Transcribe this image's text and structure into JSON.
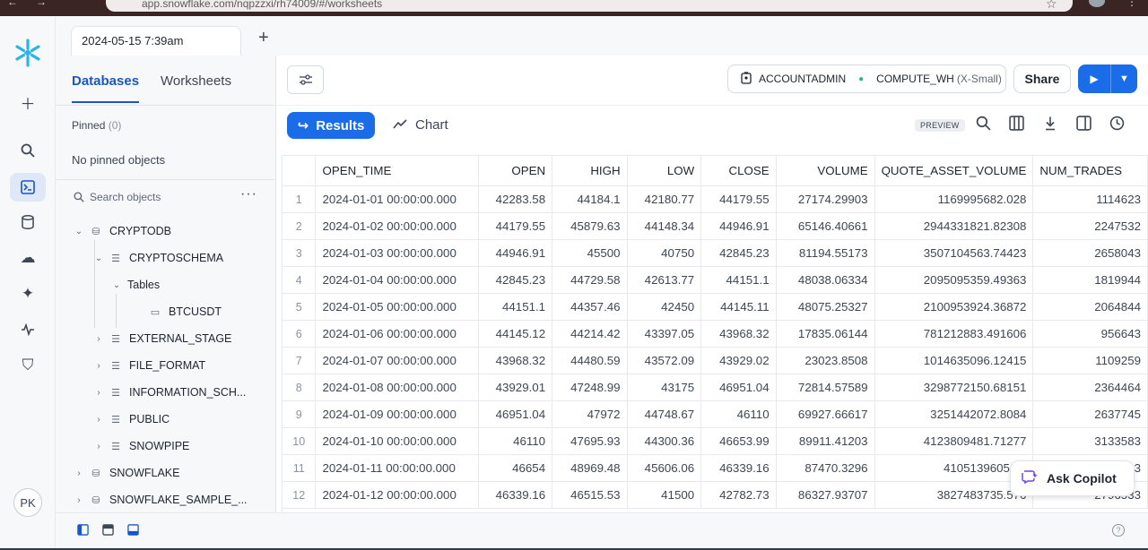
{
  "browser": {
    "url": "app.snowflake.com/nqpzzxi/rh74009/#/worksheets"
  },
  "tab": {
    "title": "2024-05-15 7:39am"
  },
  "rail": {
    "avatar_initials": "PK"
  },
  "explorer": {
    "tabs": [
      "Databases",
      "Worksheets"
    ],
    "pinned_label": "Pinned",
    "pinned_count": "(0)",
    "no_pinned": "No pinned objects",
    "search_placeholder": "Search objects",
    "tree": [
      {
        "label": "CRYPTODB",
        "level": 0,
        "chev": "⌄",
        "icon": "database-icon"
      },
      {
        "label": "CRYPTOSCHEMA",
        "level": 1,
        "chev": "⌄",
        "icon": "schema-icon"
      },
      {
        "label": "Tables",
        "level": 2,
        "chev": "⌄",
        "icon": ""
      },
      {
        "label": "BTCUSDT",
        "level": 3,
        "chev": "",
        "icon": "table-icon"
      },
      {
        "label": "EXTERNAL_STAGE",
        "level": 1,
        "chev": "›",
        "icon": "schema-icon"
      },
      {
        "label": "FILE_FORMAT",
        "level": 1,
        "chev": "›",
        "icon": "schema-icon"
      },
      {
        "label": "INFORMATION_SCH...",
        "level": 1,
        "chev": "›",
        "icon": "schema-icon"
      },
      {
        "label": "PUBLIC",
        "level": 1,
        "chev": "›",
        "icon": "schema-icon"
      },
      {
        "label": "SNOWPIPE",
        "level": 1,
        "chev": "›",
        "icon": "schema-icon"
      },
      {
        "label": "SNOWFLAKE",
        "level": 0,
        "chev": "›",
        "icon": "shared-db-icon"
      },
      {
        "label": "SNOWFLAKE_SAMPLE_...",
        "level": 0,
        "chev": "›",
        "icon": "shared-db-icon"
      }
    ]
  },
  "toolbar": {
    "role": "ACCOUNTADMIN",
    "warehouse": "COMPUTE_WH",
    "warehouse_size": "(X-Small)",
    "share_label": "Share"
  },
  "results": {
    "results_label": "Results",
    "chart_label": "Chart",
    "preview_label": "PREVIEW",
    "columns": [
      "",
      "OPEN_TIME",
      "OPEN",
      "HIGH",
      "LOW",
      "CLOSE",
      "VOLUME",
      "QUOTE_ASSET_VOLUME",
      "NUM_TRADES"
    ],
    "rows": [
      [
        "1",
        "2024-01-01 00:00:00.000",
        "42283.58",
        "44184.1",
        "42180.77",
        "44179.55",
        "27174.29903",
        "1169995682.028",
        "1114623"
      ],
      [
        "2",
        "2024-01-02 00:00:00.000",
        "44179.55",
        "45879.63",
        "44148.34",
        "44946.91",
        "65146.40661",
        "2944331821.82308",
        "2247532"
      ],
      [
        "3",
        "2024-01-03 00:00:00.000",
        "44946.91",
        "45500",
        "40750",
        "42845.23",
        "81194.55173",
        "3507104563.74423",
        "2658043"
      ],
      [
        "4",
        "2024-01-04 00:00:00.000",
        "42845.23",
        "44729.58",
        "42613.77",
        "44151.1",
        "48038.06334",
        "2095095359.49363",
        "1819944"
      ],
      [
        "5",
        "2024-01-05 00:00:00.000",
        "44151.1",
        "44357.46",
        "42450",
        "44145.11",
        "48075.25327",
        "2100953924.36872",
        "2064844"
      ],
      [
        "6",
        "2024-01-06 00:00:00.000",
        "44145.12",
        "44214.42",
        "43397.05",
        "43968.32",
        "17835.06144",
        "781212883.491606",
        "956643"
      ],
      [
        "7",
        "2024-01-07 00:00:00.000",
        "43968.32",
        "44480.59",
        "43572.09",
        "43929.02",
        "23023.8508",
        "1014635096.12415",
        "1109259"
      ],
      [
        "8",
        "2024-01-08 00:00:00.000",
        "43929.01",
        "47248.99",
        "43175",
        "46951.04",
        "72814.57589",
        "3298772150.68151",
        "2364464"
      ],
      [
        "9",
        "2024-01-09 00:00:00.000",
        "46951.04",
        "47972",
        "44748.67",
        "46110",
        "69927.66617",
        "3251442072.8084",
        "2637745"
      ],
      [
        "10",
        "2024-01-10 00:00:00.000",
        "46110",
        "47695.93",
        "44300.36",
        "46653.99",
        "89911.41203",
        "4123809481.71277",
        "3133583"
      ],
      [
        "11",
        "2024-01-11 00:00:00.000",
        "46654",
        "48969.48",
        "45606.06",
        "46339.16",
        "87470.3296",
        "4105139605.03",
        "3131543"
      ],
      [
        "12",
        "2024-01-12 00:00:00.000",
        "46339.16",
        "46515.53",
        "41500",
        "42782.73",
        "86327.93707",
        "3827483735.576",
        "2796533"
      ]
    ]
  },
  "copilot": {
    "label": "Ask Copilot"
  }
}
